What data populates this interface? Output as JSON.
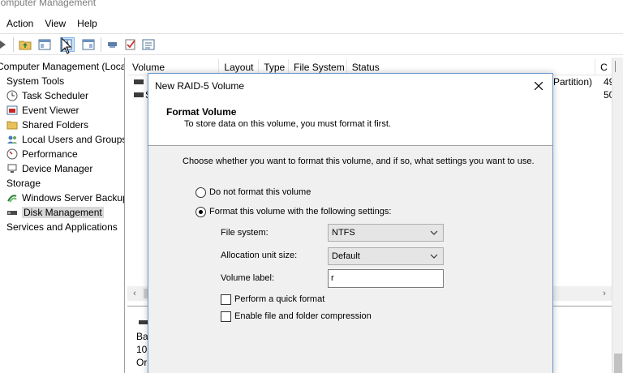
{
  "window": {
    "title": "Computer Management"
  },
  "menu": [
    "Action",
    "View",
    "Help"
  ],
  "toolbar": [
    "back-icon",
    "folder-up-icon",
    "console-tree-icon",
    "properties-icon",
    "help-icon",
    "show-hide-icon",
    "key-icon",
    "check-icon",
    "list-icon"
  ],
  "tree": {
    "root": "Computer Management (Local",
    "system_tools": "System Tools",
    "task_scheduler": "Task Scheduler",
    "event_viewer": "Event Viewer",
    "shared_folders": "Shared Folders",
    "local_users": "Local Users and Groups",
    "performance": "Performance",
    "device_manager": "Device Manager",
    "storage": "Storage",
    "wsb": "Windows Server Backup",
    "disk_management": "Disk Management",
    "services": "Services and Applications"
  },
  "list": {
    "columns": [
      "Volume",
      "Layout",
      "Type",
      "File System",
      "Status",
      "C"
    ],
    "rows": [
      {
        "status": "Partition)",
        "cap": "49"
      },
      {
        "volume_initial": "S",
        "cap": "50"
      }
    ]
  },
  "lower": {
    "line1": "Ba",
    "line2": "10:",
    "line3": "Or"
  },
  "dialog": {
    "title": "New RAID-5 Volume",
    "heading": "Format Volume",
    "subheading": "To store data on this volume, you must format it first.",
    "intro": "Choose whether you want to format this volume, and if so, what settings you want to use.",
    "option_no_format": "Do not format this volume",
    "option_format": "Format this volume with the following settings:",
    "file_system_label": "File system:",
    "file_system_value": "NTFS",
    "alloc_label": "Allocation unit size:",
    "alloc_value": "Default",
    "volume_label_label": "Volume label:",
    "volume_label_value": "r",
    "quick_format": "Perform a quick format",
    "compression": "Enable file and folder compression"
  }
}
